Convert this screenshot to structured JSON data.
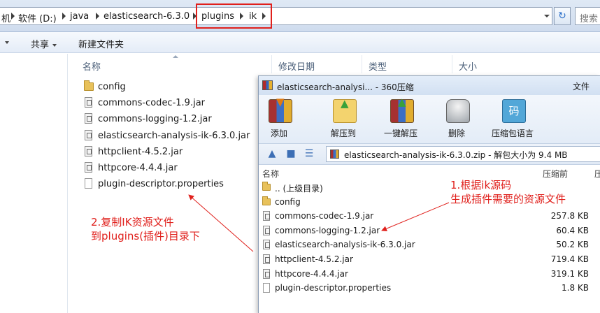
{
  "explorer": {
    "breadcrumb": {
      "left_fragment": "机",
      "drive": "软件 (D:)",
      "folder1": "java",
      "folder2": "elasticsearch-6.3.0",
      "folder3": "plugins",
      "folder4": "ik"
    },
    "refresh_glyph": "↻",
    "search_placeholder": "搜索",
    "toolbar": {
      "organize_caret_label": "",
      "share_label": "共享",
      "new_folder_label": "新建文件夹"
    },
    "columns": {
      "name": "名称",
      "modified": "修改日期",
      "type": "类型",
      "size": "大小"
    },
    "files": [
      {
        "name": "config",
        "icon": "folder-icon"
      },
      {
        "name": "commons-codec-1.9.jar",
        "icon": "jar-file-icon"
      },
      {
        "name": "commons-logging-1.2.jar",
        "icon": "jar-file-icon"
      },
      {
        "name": "elasticsearch-analysis-ik-6.3.0.jar",
        "icon": "jar-file-icon"
      },
      {
        "name": "httpclient-4.5.2.jar",
        "icon": "jar-file-icon"
      },
      {
        "name": "httpcore-4.4.4.jar",
        "icon": "jar-file-icon"
      },
      {
        "name": "plugin-descriptor.properties",
        "icon": "file-icon"
      }
    ]
  },
  "zip_window": {
    "title": "elasticsearch-analysi... - 360压缩",
    "file_menu": "文件",
    "ribbon": {
      "add": "添加",
      "extract_to": "解压到",
      "one_click_extract": "一键解压",
      "delete": "删除",
      "archive_language": "压缩包语言",
      "language_icon_glyph": "码"
    },
    "path_text": "elasticsearch-analysis-ik-6.3.0.zip - 解包大小为 9.4 MB",
    "columns": {
      "name": "名称",
      "compressed": "压缩前",
      "ratio": "压"
    },
    "rows": [
      {
        "name": ".. (上级目录)",
        "size": "",
        "icon": "folder-icon"
      },
      {
        "name": "config",
        "size": "",
        "icon": "folder-icon"
      },
      {
        "name": "commons-codec-1.9.jar",
        "size": "257.8 KB",
        "icon": "jar-file-icon"
      },
      {
        "name": "commons-logging-1.2.jar",
        "size": "60.4 KB",
        "icon": "jar-file-icon"
      },
      {
        "name": "elasticsearch-analysis-ik-6.3.0.jar",
        "size": "50.2 KB",
        "icon": "jar-file-icon"
      },
      {
        "name": "httpclient-4.5.2.jar",
        "size": "719.4 KB",
        "icon": "jar-file-icon"
      },
      {
        "name": "httpcore-4.4.4.jar",
        "size": "319.1 KB",
        "icon": "jar-file-icon"
      },
      {
        "name": "plugin-descriptor.properties",
        "size": "1.8 KB",
        "icon": "file-icon"
      }
    ]
  },
  "annotations": {
    "left_line1": "2.复制IK资源文件",
    "left_line2": "到plugins(插件)目录下",
    "right_line1": "1.根据ik源码",
    "right_line2": "生成插件需要的资源文件",
    "color": "#e0201c"
  }
}
